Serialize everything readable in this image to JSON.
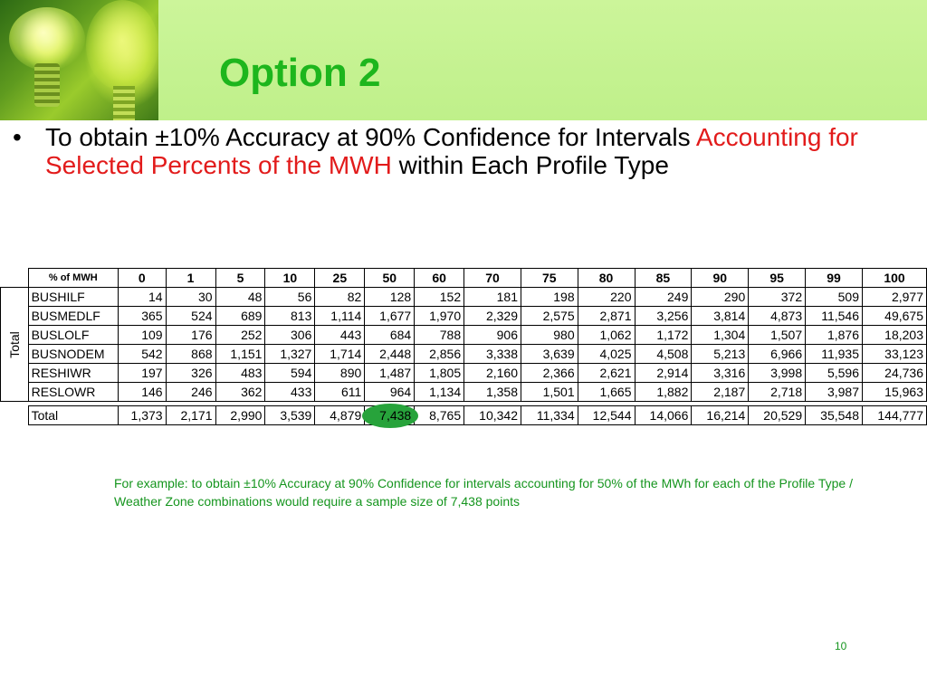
{
  "title": "Option 2",
  "bullet": {
    "part1": "To obtain ±10% Accuracy at 90% Confidence for Intervals ",
    "part2_red": "Accounting for Selected Percents of the MWH",
    "part3": " within Each Profile Type"
  },
  "table": {
    "header_label": "% of MWH",
    "side_label": "Total",
    "columns": [
      "0",
      "1",
      "5",
      "10",
      "25",
      "50",
      "60",
      "70",
      "75",
      "80",
      "85",
      "90",
      "95",
      "99",
      "100"
    ],
    "rows": [
      {
        "label": "BUSHILF",
        "values": [
          "14",
          "30",
          "48",
          "56",
          "82",
          "128",
          "152",
          "181",
          "198",
          "220",
          "249",
          "290",
          "372",
          "509",
          "2,977"
        ]
      },
      {
        "label": "BUSMEDLF",
        "values": [
          "365",
          "524",
          "689",
          "813",
          "1,114",
          "1,677",
          "1,970",
          "2,329",
          "2,575",
          "2,871",
          "3,256",
          "3,814",
          "4,873",
          "11,546",
          "49,675"
        ]
      },
      {
        "label": "BUSLOLF",
        "values": [
          "109",
          "176",
          "252",
          "306",
          "443",
          "684",
          "788",
          "906",
          "980",
          "1,062",
          "1,172",
          "1,304",
          "1,507",
          "1,876",
          "18,203"
        ]
      },
      {
        "label": "BUSNODEM",
        "values": [
          "542",
          "868",
          "1,151",
          "1,327",
          "1,714",
          "2,448",
          "2,856",
          "3,338",
          "3,639",
          "4,025",
          "4,508",
          "5,213",
          "6,966",
          "11,935",
          "33,123"
        ]
      },
      {
        "label": "RESHIWR",
        "values": [
          "197",
          "326",
          "483",
          "594",
          "890",
          "1,487",
          "1,805",
          "2,160",
          "2,366",
          "2,621",
          "2,914",
          "3,316",
          "3,998",
          "5,596",
          "24,736"
        ]
      },
      {
        "label": "RESLOWR",
        "values": [
          "146",
          "246",
          "362",
          "433",
          "611",
          "964",
          "1,134",
          "1,358",
          "1,501",
          "1,665",
          "1,882",
          "2,187",
          "2,718",
          "3,987",
          "15,963"
        ]
      }
    ],
    "total": {
      "label": "Total",
      "values": [
        "1,373",
        "2,171",
        "2,990",
        "3,539",
        "4,879",
        "7,438",
        "8,765",
        "10,342",
        "11,334",
        "12,544",
        "14,066",
        "16,214",
        "20,529",
        "35,548",
        "144,777"
      ]
    },
    "highlight_color": "#27a33b"
  },
  "note": "For example: to obtain ±10% Accuracy at 90% Confidence for intervals accounting for 50% of the MWh for each of the Profile Type / Weather Zone combinations would require a sample size of 7,438 points",
  "page_number": "10",
  "colors": {
    "title": "#1db61d",
    "accent_red": "#e21b1b",
    "note": "#15951e",
    "header_band": "#c6f292"
  },
  "icons": [
    "light-bulb-image"
  ]
}
